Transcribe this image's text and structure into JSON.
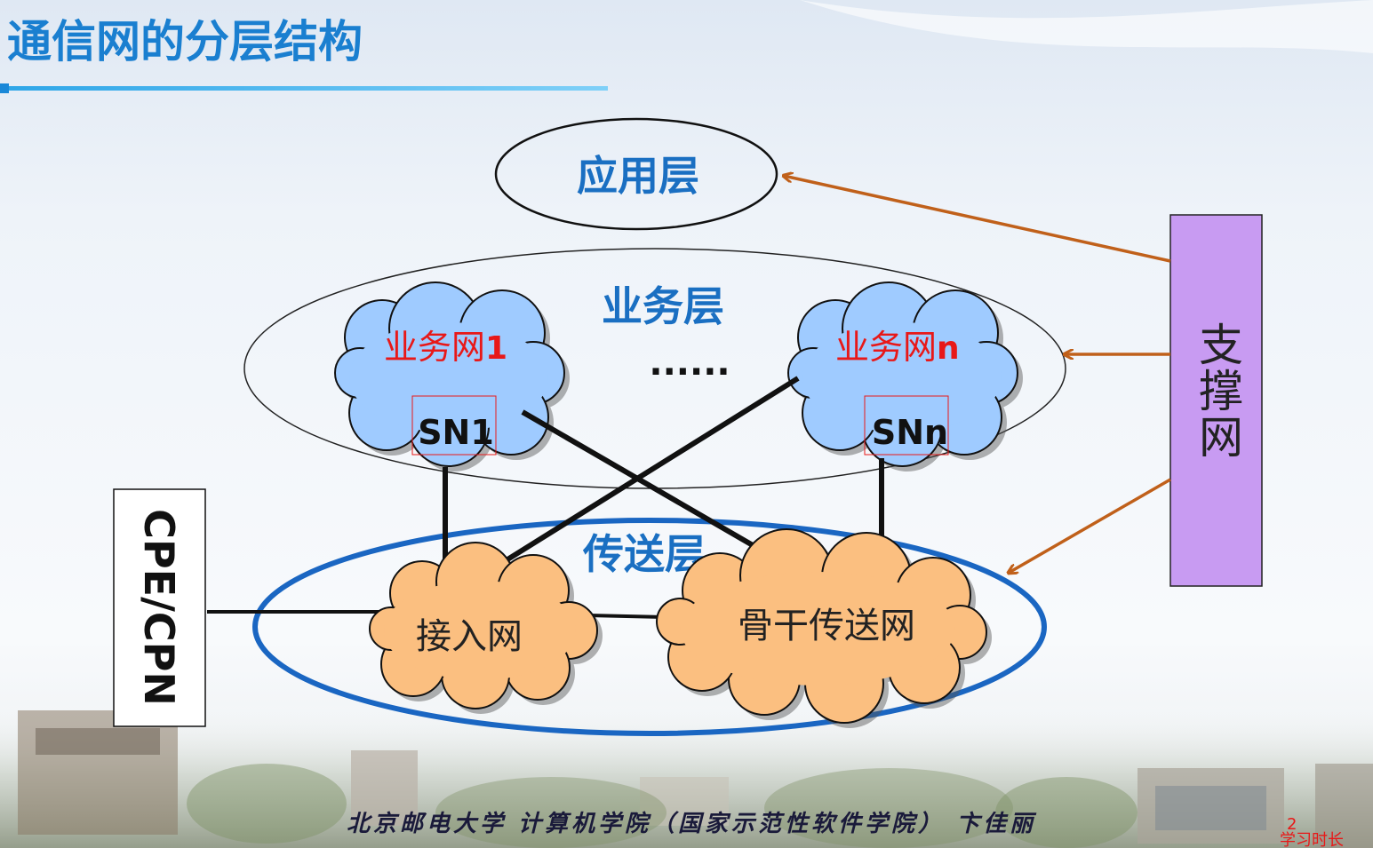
{
  "slide": {
    "title": "通信网的分层结构",
    "footer": "北京邮电大学 计算机学院（国家示范性软件学院） 卞佳丽",
    "page_number": "2",
    "timer_label": "学习时长"
  },
  "diagram": {
    "application_layer": "应用层",
    "service_layer": "业务层",
    "transport_layer": "传送层",
    "service_net_1_prefix": "业务网",
    "service_net_1_suffix": "1",
    "service_net_n_prefix": "业务网",
    "service_net_n_suffix": "n",
    "ellipsis": "......",
    "sn1": "SN1",
    "snn": "SNn",
    "access_net": "接入网",
    "backbone_net": "骨干传送网",
    "cpe": "CPE/CPN",
    "support_net": [
      "支",
      "撑",
      "网"
    ]
  },
  "colors": {
    "title_blue": "#1a7fd0",
    "service_cloud": "#9fcbff",
    "transport_cloud": "#fbbf80",
    "support_box": "#c89bf2",
    "arrow": "#c0601a",
    "transport_ellipse": "#1a66c2",
    "accent_red": "#e81818"
  }
}
